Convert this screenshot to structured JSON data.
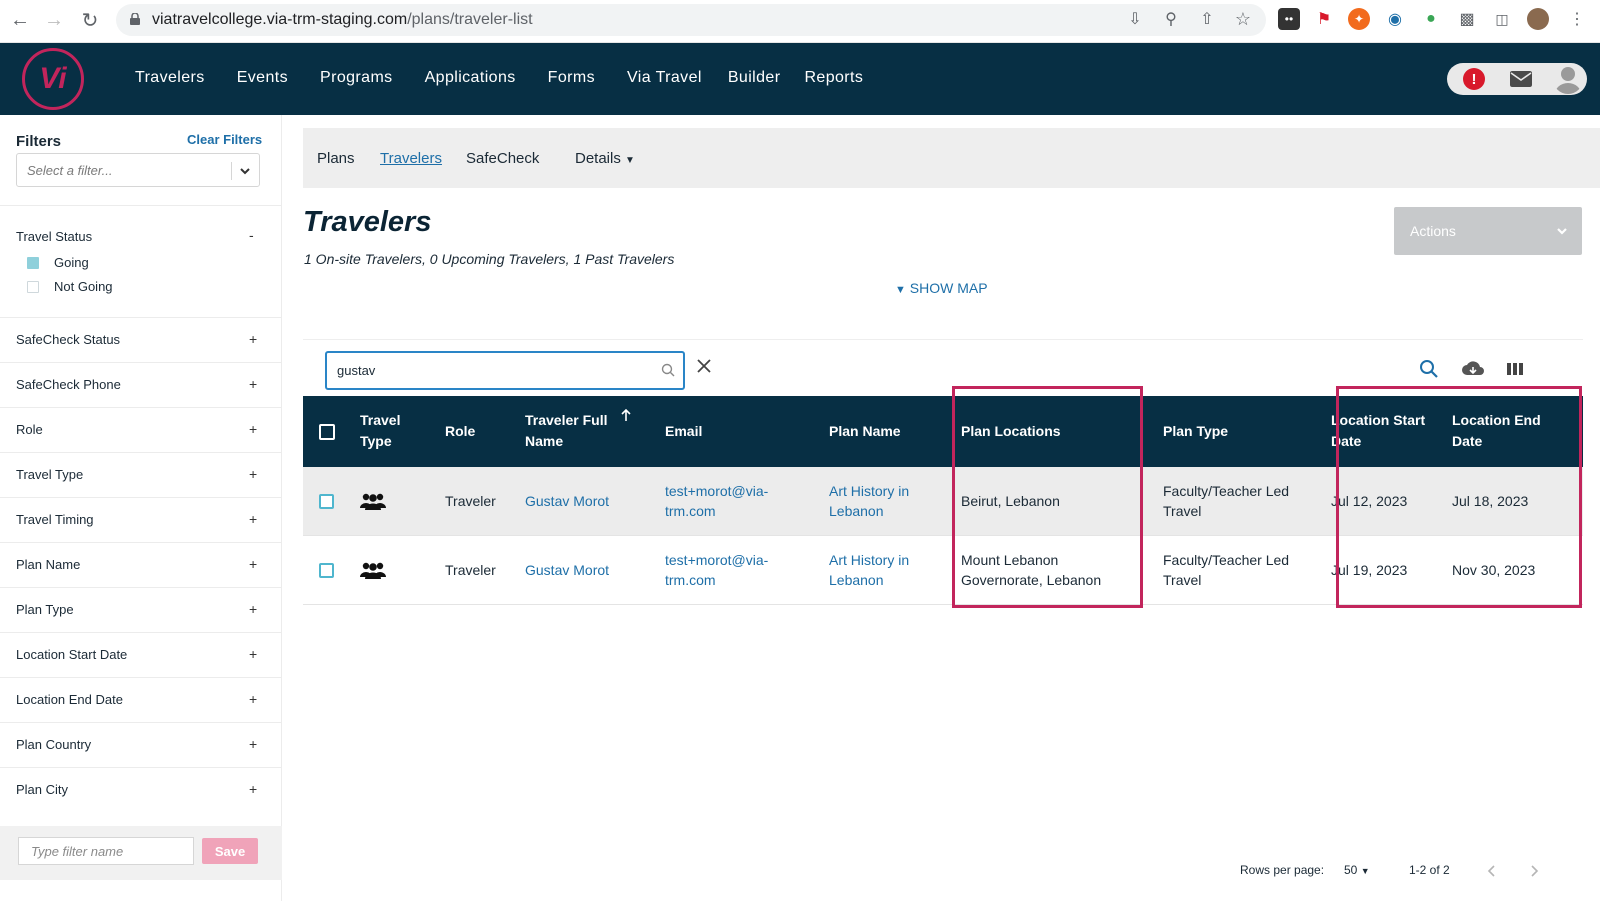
{
  "browser": {
    "url_domain": "viatravelcollege.via-trm-staging.com",
    "url_path": "/plans/traveler-list"
  },
  "header": {
    "logo_text": "Vi",
    "nav": [
      "Travelers",
      "Events",
      "Programs",
      "Applications",
      "Forms",
      "Via Travel",
      "Builder",
      "Reports"
    ]
  },
  "sidebar": {
    "title": "Filters",
    "clear_label": "Clear Filters",
    "select_placeholder": "Select a filter...",
    "travel_status": {
      "title": "Travel Status",
      "toggle": "-",
      "options": [
        {
          "label": "Going",
          "checked": true
        },
        {
          "label": "Not Going",
          "checked": false
        }
      ]
    },
    "facets": [
      "SafeCheck Status",
      "SafeCheck Phone",
      "Role",
      "Travel Type",
      "Travel Timing",
      "Plan Name",
      "Plan Type",
      "Location Start Date",
      "Location End Date",
      "Plan Country",
      "Plan City"
    ],
    "facet_toggle": "+",
    "save_placeholder": "Type filter name",
    "save_label": "Save"
  },
  "tabs": [
    "Plans",
    "Travelers",
    "SafeCheck",
    "Details"
  ],
  "active_tab": "Travelers",
  "page": {
    "title": "Travelers",
    "subtitle": "1 On-site Travelers, 0 Upcoming Travelers, 1 Past Travelers",
    "actions_label": "Actions",
    "show_map_label": "SHOW MAP"
  },
  "grid": {
    "search_value": "gustav",
    "columns": {
      "travel_type": "Travel Type",
      "role": "Role",
      "traveler_full_name": "Traveler Full Name",
      "email": "Email",
      "plan_name": "Plan Name",
      "plan_locations": "Plan Locations",
      "plan_type": "Plan Type",
      "location_start_date": "Location Start Date",
      "location_end_date": "Location End Date"
    },
    "rows": [
      {
        "role": "Traveler",
        "name": "Gustav Morot",
        "email_1": "test+morot@via-",
        "email_2": "trm.com",
        "plan_1": "Art History in",
        "plan_2": "Lebanon",
        "loc_1": "Beirut, Lebanon",
        "loc_2": "",
        "type_1": "Faculty/Teacher Led",
        "type_2": "Travel",
        "start": "Jul 12, 2023",
        "end": "Jul 18, 2023"
      },
      {
        "role": "Traveler",
        "name": "Gustav Morot",
        "email_1": "test+morot@via-",
        "email_2": "trm.com",
        "plan_1": "Art History in",
        "plan_2": "Lebanon",
        "loc_1": "Mount Lebanon",
        "loc_2": "Governorate, Lebanon",
        "type_1": "Faculty/Teacher Led",
        "type_2": "Travel",
        "start": "Jul 19, 2023",
        "end": "Nov 30, 2023"
      }
    ],
    "footer": {
      "rows_per_page_label": "Rows per page:",
      "rows_per_page_value": "50",
      "range": "1-2 of 2"
    }
  },
  "colors": {
    "navy": "#072f44",
    "link": "#1e6fa8",
    "highlight": "#c2255c"
  }
}
